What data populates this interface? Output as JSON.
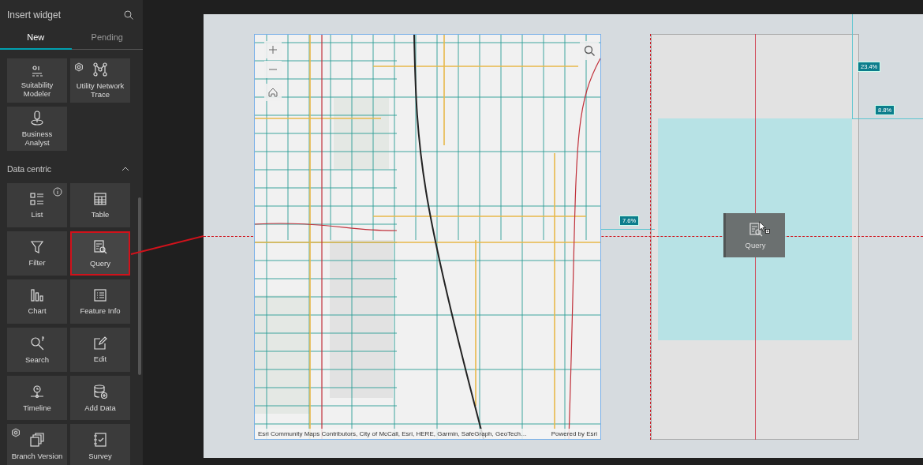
{
  "sidebar": {
    "title": "Insert widget",
    "tabs": [
      {
        "label": "New",
        "selected": true
      },
      {
        "label": "Pending",
        "selected": false
      }
    ],
    "groups": [
      {
        "items": [
          {
            "label": "Suitability Modeler",
            "kind": "modeler",
            "hex_badge": false,
            "info_badge": false,
            "selected": false
          },
          {
            "label": "Utility Network Trace",
            "kind": "network",
            "hex_badge": true,
            "info_badge": false,
            "selected": false
          },
          {
            "label": "Business Analyst",
            "kind": "analyst",
            "hex_badge": false,
            "info_badge": false,
            "selected": false
          }
        ]
      },
      {
        "title": "Data centric",
        "expanded": true,
        "items": [
          {
            "label": "List",
            "kind": "list",
            "hex_badge": false,
            "info_badge": true,
            "selected": false
          },
          {
            "label": "Table",
            "kind": "table",
            "hex_badge": false,
            "info_badge": false,
            "selected": false
          },
          {
            "label": "Filter",
            "kind": "filter",
            "hex_badge": false,
            "info_badge": false,
            "selected": false
          },
          {
            "label": "Query",
            "kind": "query",
            "hex_badge": false,
            "info_badge": false,
            "selected": true
          },
          {
            "label": "Chart",
            "kind": "chart",
            "hex_badge": false,
            "info_badge": false,
            "selected": false
          },
          {
            "label": "Feature Info",
            "kind": "info",
            "hex_badge": false,
            "info_badge": false,
            "selected": false
          },
          {
            "label": "Search",
            "kind": "search",
            "hex_badge": false,
            "info_badge": false,
            "selected": false
          },
          {
            "label": "Edit",
            "kind": "edit",
            "hex_badge": false,
            "info_badge": false,
            "selected": false
          },
          {
            "label": "Timeline",
            "kind": "timeline",
            "hex_badge": false,
            "info_badge": false,
            "selected": false
          },
          {
            "label": "Add Data",
            "kind": "adddata",
            "hex_badge": false,
            "info_badge": false,
            "selected": false
          },
          {
            "label": "Branch Version",
            "kind": "branch",
            "hex_badge": true,
            "info_badge": false,
            "selected": false
          },
          {
            "label": "Survey",
            "kind": "survey",
            "hex_badge": false,
            "info_badge": false,
            "selected": false
          }
        ]
      }
    ]
  },
  "canvas": {
    "map": {
      "attribution": "Esri Community Maps Contributors, City of McCall, Esri, HERE, Garmin, SafeGraph, GeoTech…",
      "powered_by": "Powered by Esri"
    },
    "guides": [
      {
        "label": "23.4%"
      },
      {
        "label": "8.8%"
      },
      {
        "label": "7.6%"
      }
    ],
    "drag_preview": {
      "label": "Query"
    }
  }
}
